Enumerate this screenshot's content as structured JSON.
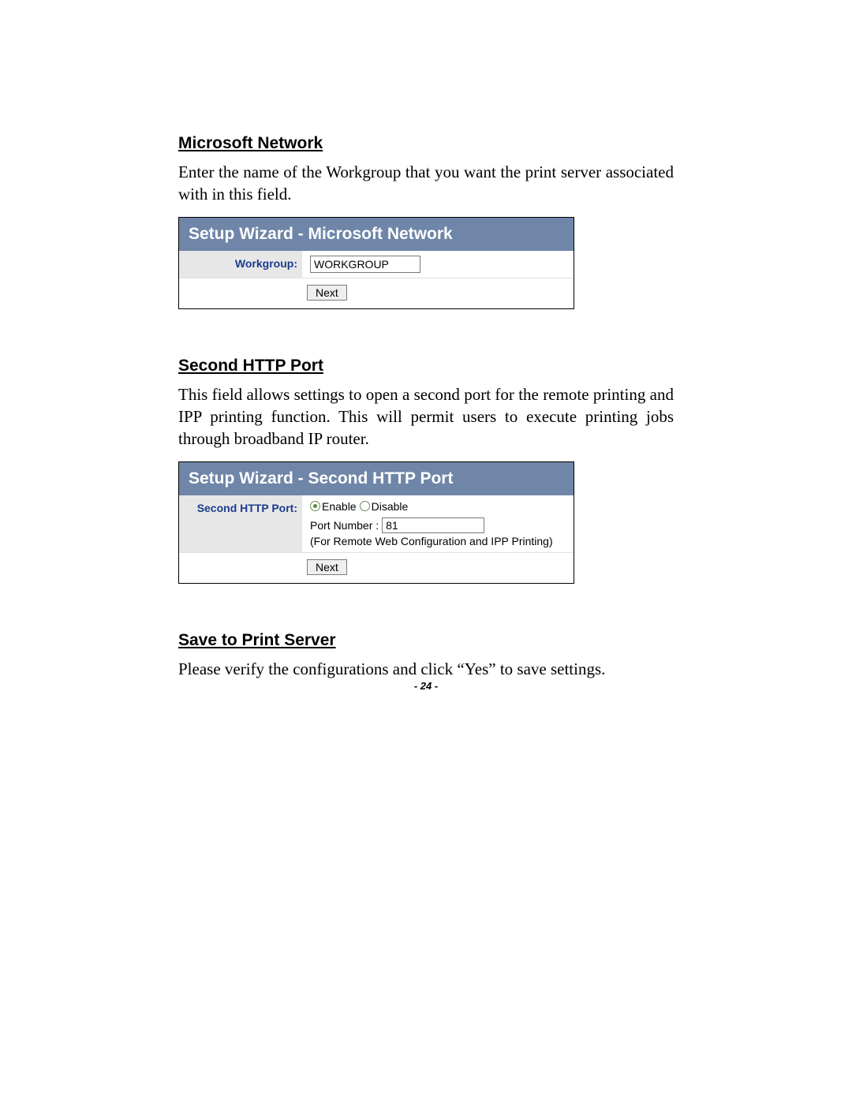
{
  "section1": {
    "heading": "Microsoft Network",
    "paragraph": "Enter the name of the Workgroup that you want the print server associated with in this field.",
    "wizard": {
      "title": "Setup Wizard - Microsoft Network",
      "workgroup_label": "Workgroup:",
      "workgroup_value": "WORKGROUP",
      "next_button": "Next"
    }
  },
  "section2": {
    "heading": "Second HTTP Port",
    "paragraph": "This field allows settings to open a second port for the remote printing and IPP printing function. This will permit users to execute printing jobs through broadband IP router.",
    "wizard": {
      "title": "Setup Wizard - Second HTTP Port",
      "field_label": "Second HTTP Port:",
      "enable_label": "Enable",
      "disable_label": "Disable",
      "port_number_label": "Port Number :",
      "port_number_value": "81",
      "hint": "(For Remote Web Configuration and IPP Printing)",
      "next_button": "Next"
    }
  },
  "section3": {
    "heading": "Save to Print Server",
    "paragraph": "Please verify the configurations and click “Yes” to save settings."
  },
  "page_number": "- 24 -"
}
